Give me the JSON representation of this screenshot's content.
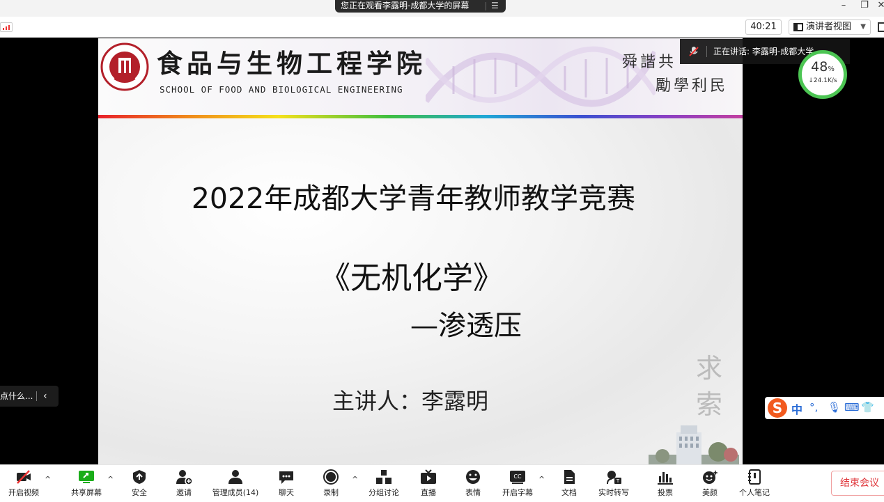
{
  "window": {
    "share_banner": "您正在观看李露明-成都大学的屏幕",
    "minimize": "–",
    "restore": "❐",
    "close": "✕"
  },
  "toolbar": {
    "timer": "40:21",
    "presenter_view_label": "演讲者视图"
  },
  "slide": {
    "college_name": "食品与生物工程学院",
    "college_name_en": "SCHOOL OF FOOD AND BIOLOGICAL ENGINEERING",
    "motto_line1": "舜諧共",
    "motto_line2": "勵學利民",
    "title": "2022年成都大学青年教师教学竞赛",
    "subject": "《无机化学》",
    "topic": "—渗透压",
    "speaker": "主讲人：李露明",
    "calligraphy": "求索"
  },
  "overlay": {
    "speaking_now": "正在讲话: 李露明-成都大学",
    "network_percent": "48",
    "network_percent_unit": "%",
    "network_speed": "↓24.1K/s",
    "chat_hint": "点什么...",
    "ime_zh": "中"
  },
  "bottombar": {
    "items": [
      {
        "label": "开启视频"
      },
      {
        "label": "共享屏幕"
      },
      {
        "label": "安全"
      },
      {
        "label": "邀请"
      },
      {
        "label": "管理成员(14)"
      },
      {
        "label": "聊天"
      },
      {
        "label": "录制"
      },
      {
        "label": "分组讨论"
      },
      {
        "label": "直播"
      },
      {
        "label": "表情"
      },
      {
        "label": "开启字幕"
      },
      {
        "label": "文档"
      },
      {
        "label": "实时转写"
      },
      {
        "label": "投票"
      },
      {
        "label": "美颜"
      },
      {
        "label": "个人笔记"
      }
    ],
    "end_meeting": "结束会议"
  },
  "colors": {
    "accent_green": "#1aad19",
    "danger_red": "#e0393e",
    "ime_orange": "#f25a1e",
    "gauge_green": "#4cc553"
  }
}
